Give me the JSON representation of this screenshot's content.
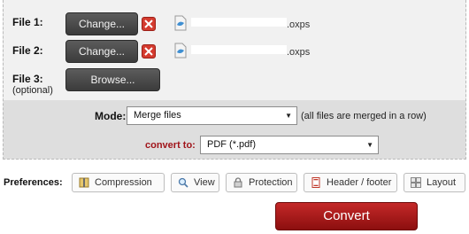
{
  "files": [
    {
      "label": "File 1:",
      "button_label": "Change...",
      "file_extension": ".oxps"
    },
    {
      "label": "File 2:",
      "button_label": "Change...",
      "file_extension": ".oxps"
    },
    {
      "label": "File 3:",
      "sublabel": "(optional)",
      "button_label": "Browse..."
    }
  ],
  "mode": {
    "label": "Mode:",
    "selected": "Merge files",
    "hint": "(all files are merged in a row)"
  },
  "convert_to": {
    "label": "convert to:",
    "selected": "PDF (*.pdf)"
  },
  "preferences": {
    "label": "Preferences:",
    "buttons": [
      {
        "label": "Compression",
        "icon": "compression-icon"
      },
      {
        "label": "View",
        "icon": "magnifier-icon"
      },
      {
        "label": "Protection",
        "icon": "lock-icon"
      },
      {
        "label": "Header / footer",
        "icon": "document-icon"
      },
      {
        "label": "Layout",
        "icon": "grid-icon"
      }
    ]
  },
  "convert_button": {
    "label": "Convert"
  },
  "colors": {
    "accent": "#a0141a",
    "delete": "#d43b2f",
    "dark_button": "#4a4a4a"
  }
}
